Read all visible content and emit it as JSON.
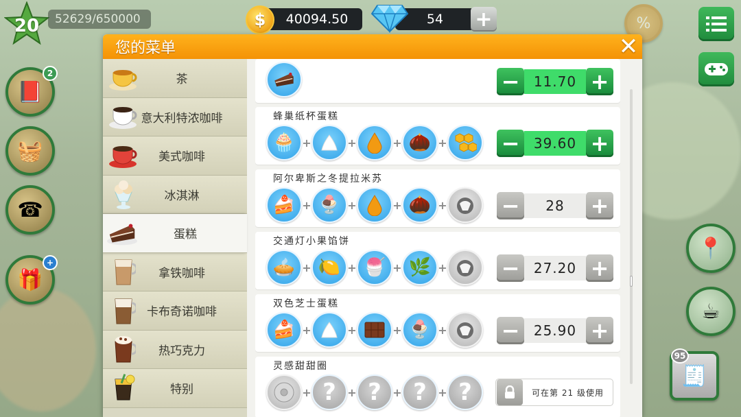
{
  "hud": {
    "level": "20",
    "xp": "52629/650000",
    "coins": "40094.50",
    "gems": "54",
    "add_label": "+",
    "coin_symbol": "$"
  },
  "side_badges": {
    "recipe_book": "2",
    "gift": "+",
    "register": "95"
  },
  "dialog": {
    "title": "您的菜单",
    "close": "✕"
  },
  "categories": [
    {
      "label": "茶",
      "icon": "tea-cup-icon"
    },
    {
      "label": "意大利特浓咖啡",
      "icon": "espresso-cup-icon"
    },
    {
      "label": "美式咖啡",
      "icon": "americano-cup-icon"
    },
    {
      "label": "冰淇淋",
      "icon": "ice-cream-icon"
    },
    {
      "label": "蛋糕",
      "icon": "cake-slice-icon",
      "active": true
    },
    {
      "label": "拿铁咖啡",
      "icon": "latte-glass-icon"
    },
    {
      "label": "卡布奇诺咖啡",
      "icon": "cappuccino-glass-icon"
    },
    {
      "label": "热巧克力",
      "icon": "hot-chocolate-icon"
    },
    {
      "label": "特别",
      "icon": "special-drink-icon"
    }
  ],
  "recipes": [
    {
      "title": "",
      "price": "11.70",
      "enabled": true
    },
    {
      "title": "蜂巢纸杯蛋糕",
      "price": "39.60",
      "enabled": true
    },
    {
      "title": "阿尔卑斯之冬提拉米苏",
      "price": "28",
      "enabled": false
    },
    {
      "title": "交通灯小果馅饼",
      "price": "27.20",
      "enabled": false
    },
    {
      "title": "双色芝士蛋糕",
      "price": "25.90",
      "enabled": false
    },
    {
      "title": "灵感甜甜圈",
      "locked_text": "可在第 21 级使用"
    }
  ],
  "symbols": {
    "plus": "+",
    "minus": "−",
    "unknown": "?"
  },
  "colors": {
    "header_orange": "#f7a010",
    "price_green": "#3fdc6a",
    "ingredient_blue": "#2fa2e8"
  }
}
